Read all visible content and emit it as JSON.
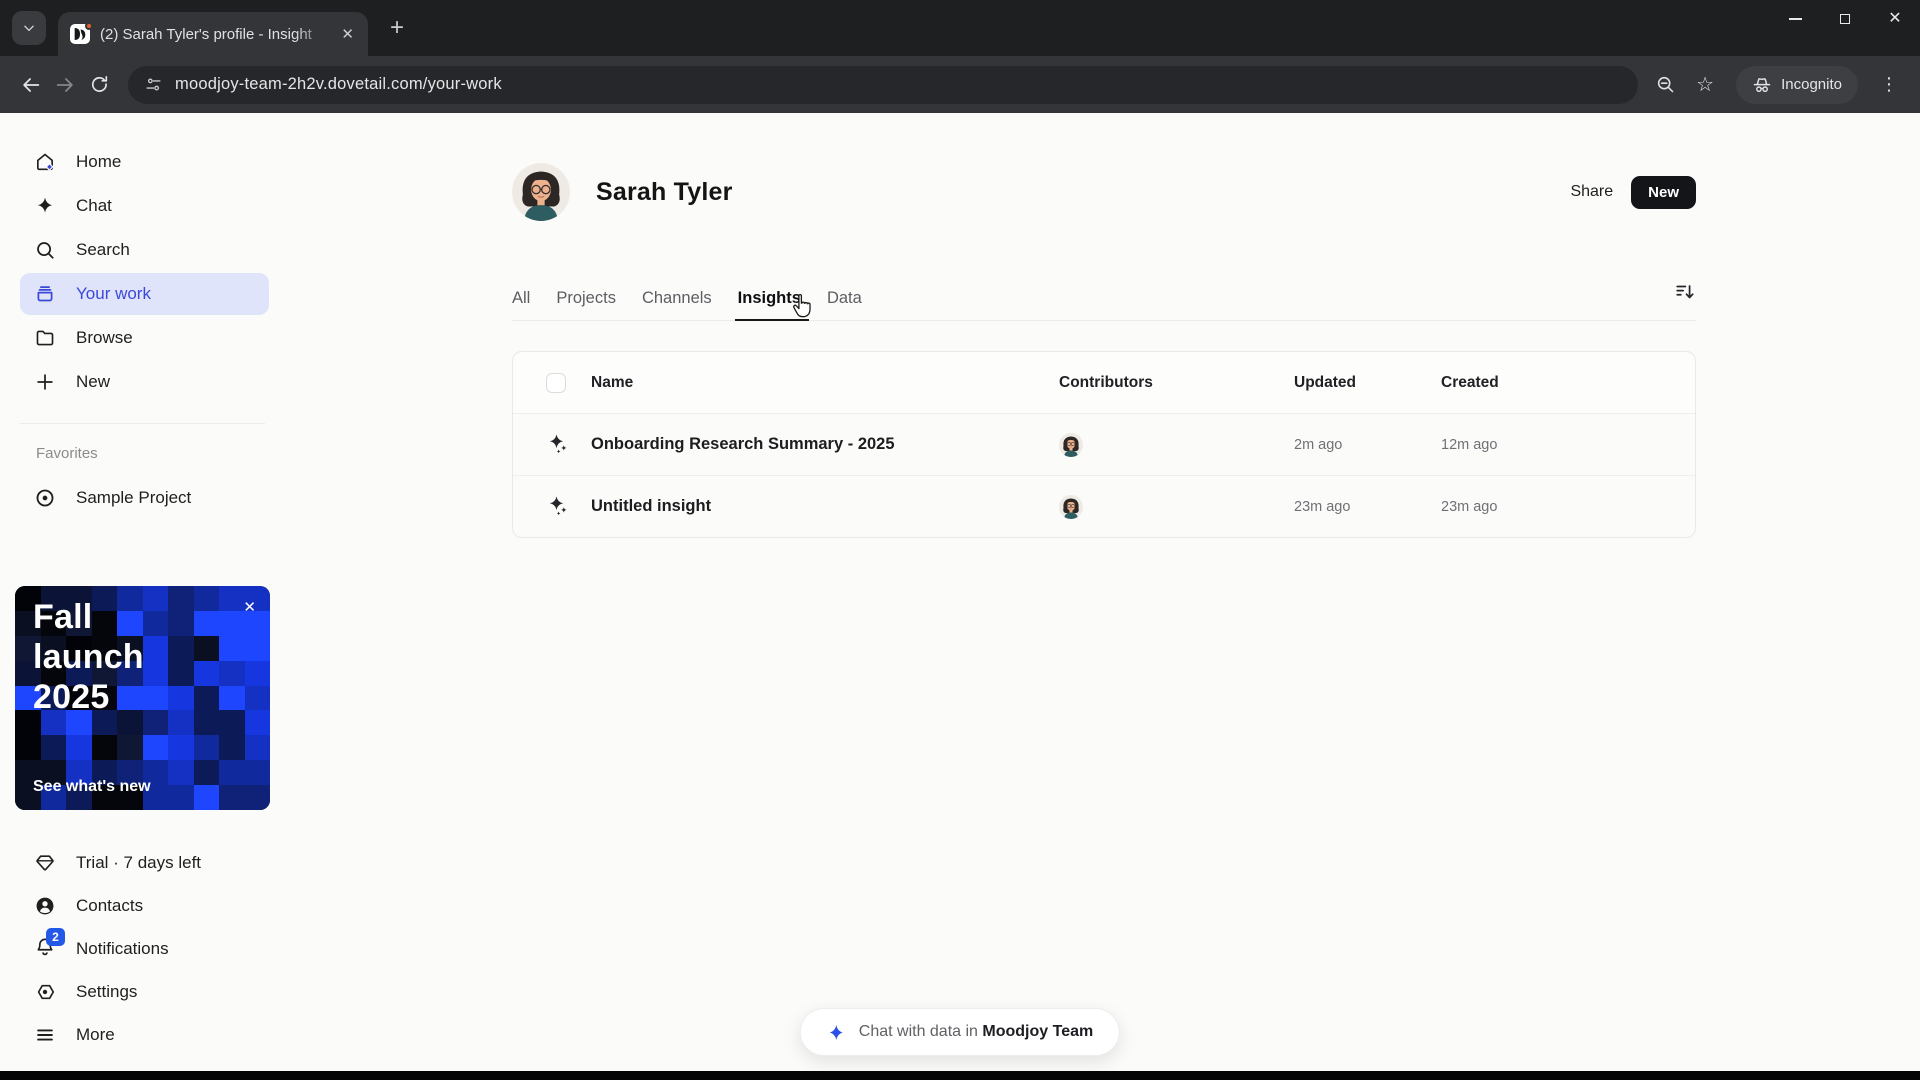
{
  "colors": {
    "accent_blue": "#3b49d8",
    "sidebar_active_bg": "#e0e4fa",
    "notification_badge_blue": "#2458e6",
    "new_button_bg": "#141519",
    "banner_blue": "#1e46ff",
    "chrome_dark": "#1e1f21"
  },
  "browser": {
    "tab_title": "(2) Sarah Tyler's profile - Insight",
    "url": "moodjoy-team-2h2v.dovetail.com/your-work",
    "incognito_label": "Incognito",
    "icons": [
      "tab-search-chevron",
      "dovetail-favicon",
      "tab-close",
      "new-tab-plus",
      "minimize",
      "restore",
      "close",
      "back-arrow",
      "forward-arrow",
      "reload",
      "site-info-tune",
      "zoom-out-magnifier",
      "bookmark-star",
      "incognito-hat",
      "three-dot-menu"
    ]
  },
  "sidebar": {
    "items": [
      {
        "label": "Home",
        "icon": "home-icon",
        "active": false
      },
      {
        "label": "Chat",
        "icon": "sparkle-icon",
        "active": false
      },
      {
        "label": "Search",
        "icon": "search-icon",
        "active": false
      },
      {
        "label": "Your work",
        "icon": "tray-icon",
        "active": true
      },
      {
        "label": "Browse",
        "icon": "folder-icon",
        "active": false
      },
      {
        "label": "New",
        "icon": "plus-icon",
        "active": false
      }
    ],
    "favorites_label": "Favorites",
    "favorites": [
      {
        "label": "Sample Project",
        "icon": "target-icon"
      }
    ],
    "banner": {
      "title": "Fall launch 2025",
      "cta": "See what's new",
      "close_glyph": "✕"
    },
    "footer_items": [
      {
        "label": "Trial · 7 days left",
        "icon": "gem-icon"
      },
      {
        "label": "Contacts",
        "icon": "contact-icon"
      },
      {
        "label": "Notifications",
        "icon": "bell-icon",
        "badge": "2"
      },
      {
        "label": "Settings",
        "icon": "settings-icon"
      },
      {
        "label": "More",
        "icon": "menu-lines-icon"
      }
    ]
  },
  "profile": {
    "name": "Sarah Tyler",
    "share_label": "Share",
    "new_label": "New"
  },
  "tabs": [
    {
      "label": "All",
      "active": false
    },
    {
      "label": "Projects",
      "active": false
    },
    {
      "label": "Channels",
      "active": false
    },
    {
      "label": "Insights",
      "active": true
    },
    {
      "label": "Data",
      "active": false
    }
  ],
  "table": {
    "columns": {
      "name": "Name",
      "contributors": "Contributors",
      "updated": "Updated",
      "created": "Created"
    },
    "rows": [
      {
        "name": "Onboarding Research Summary - 2025",
        "icon": "insight-sparkles-icon",
        "updated": "2m ago",
        "created": "12m ago"
      },
      {
        "name": "Untitled insight",
        "icon": "insight-sparkles-icon",
        "updated": "23m ago",
        "created": "23m ago"
      }
    ]
  },
  "chat_pill": {
    "prefix": "Chat with data in",
    "team": "Moodjoy Team"
  }
}
